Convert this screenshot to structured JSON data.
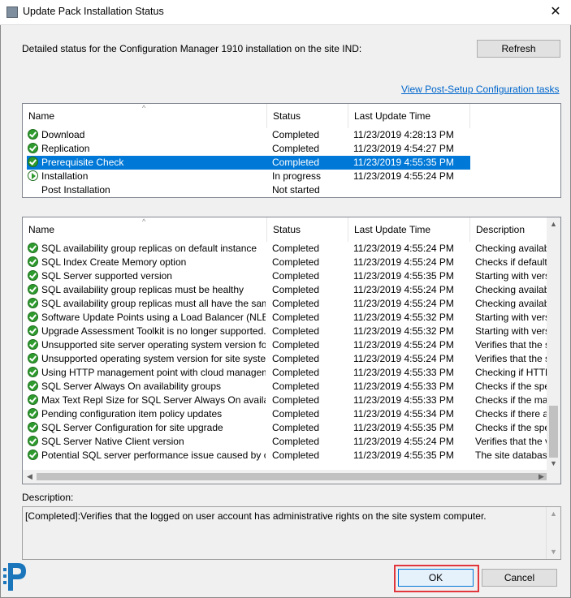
{
  "window": {
    "title": "Update Pack Installation Status",
    "close_glyph": "✕"
  },
  "status_text": "Detailed status for the Configuration Manager 1910 installation on the site IND:",
  "buttons": {
    "refresh": "Refresh",
    "ok": "OK",
    "cancel": "Cancel"
  },
  "link": "View Post-Setup Configuration tasks",
  "upper_list": {
    "columns": [
      "Name",
      "Status",
      "Last Update Time"
    ],
    "rows": [
      {
        "name": "Download",
        "status": "Completed",
        "time": "11/23/2019 4:28:13 PM",
        "icon": "check-icon"
      },
      {
        "name": "Replication",
        "status": "Completed",
        "time": "11/23/2019 4:54:27 PM",
        "icon": "check-icon"
      },
      {
        "name": "Prerequisite Check",
        "status": "Completed",
        "time": "11/23/2019 4:55:35 PM",
        "icon": "check-icon",
        "selected": true
      },
      {
        "name": "Installation",
        "status": "In progress",
        "time": "11/23/2019 4:55:24 PM",
        "icon": "in-progress-icon"
      },
      {
        "name": "Post Installation",
        "status": "Not started",
        "time": "",
        "icon": "none"
      }
    ]
  },
  "lower_list": {
    "columns": [
      "Name",
      "Status",
      "Last Update Time",
      "Description"
    ],
    "rows": [
      {
        "name": "SQL availability group replicas on default instance",
        "status": "Completed",
        "time": "11/23/2019 4:55:24 PM",
        "desc": "Checking availabili"
      },
      {
        "name": "SQL Index Create Memory option",
        "status": "Completed",
        "time": "11/23/2019 4:55:24 PM",
        "desc": "Checks if default v"
      },
      {
        "name": "SQL Server supported version",
        "status": "Completed",
        "time": "11/23/2019 4:55:35 PM",
        "desc": "Starting with versic"
      },
      {
        "name": "SQL availability group replicas must be healthy",
        "status": "Completed",
        "time": "11/23/2019 4:55:24 PM",
        "desc": "Checking availabili"
      },
      {
        "name": "SQL availability group replicas must all have the same se...",
        "status": "Completed",
        "time": "11/23/2019 4:55:24 PM",
        "desc": "Checking availabili"
      },
      {
        "name": "Software Update Points using a Load Balancer (NLB/HL...",
        "status": "Completed",
        "time": "11/23/2019 4:55:32 PM",
        "desc": "Starting with versic"
      },
      {
        "name": "Upgrade Assessment Toolkit is no longer supported.",
        "status": "Completed",
        "time": "11/23/2019 4:55:32 PM",
        "desc": "Starting with versic"
      },
      {
        "name": "Unsupported site server operating system version for Set...",
        "status": "Completed",
        "time": "11/23/2019 4:55:24 PM",
        "desc": "Verifies that the sit"
      },
      {
        "name": "Unsupported operating system version for site system role",
        "status": "Completed",
        "time": "11/23/2019 4:55:24 PM",
        "desc": "Verifies that the sit"
      },
      {
        "name": "Using HTTP management point with cloud management ...",
        "status": "Completed",
        "time": "11/23/2019 4:55:33 PM",
        "desc": "Checking if HTTP"
      },
      {
        "name": "SQL Server Always On availability groups",
        "status": "Completed",
        "time": "11/23/2019 4:55:33 PM",
        "desc": "Checks if the spec"
      },
      {
        "name": "Max Text Repl Size for SQL Server Always On availabilit...",
        "status": "Completed",
        "time": "11/23/2019 4:55:33 PM",
        "desc": "Checks if the max"
      },
      {
        "name": "Pending configuration item policy updates",
        "status": "Completed",
        "time": "11/23/2019 4:55:34 PM",
        "desc": "Checks if there are"
      },
      {
        "name": "SQL Server Configuration for site upgrade",
        "status": "Completed",
        "time": "11/23/2019 4:55:35 PM",
        "desc": "Checks if the spec"
      },
      {
        "name": "SQL Server Native Client version",
        "status": "Completed",
        "time": "11/23/2019 4:55:24 PM",
        "desc": "Verifies that the ve"
      },
      {
        "name": "Potential SQL server performance issue caused by chan...",
        "status": "Completed",
        "time": "11/23/2019 4:55:35 PM",
        "desc": "The site database"
      }
    ]
  },
  "description": {
    "label": "Description:",
    "text": "[Completed]:Verifies that the logged on user account has administrative rights on the site system computer."
  },
  "colors": {
    "accent": "#0078d7",
    "link": "#0066cc",
    "ok_highlight": "#e0363c",
    "check_green": "#2e9b2e"
  }
}
